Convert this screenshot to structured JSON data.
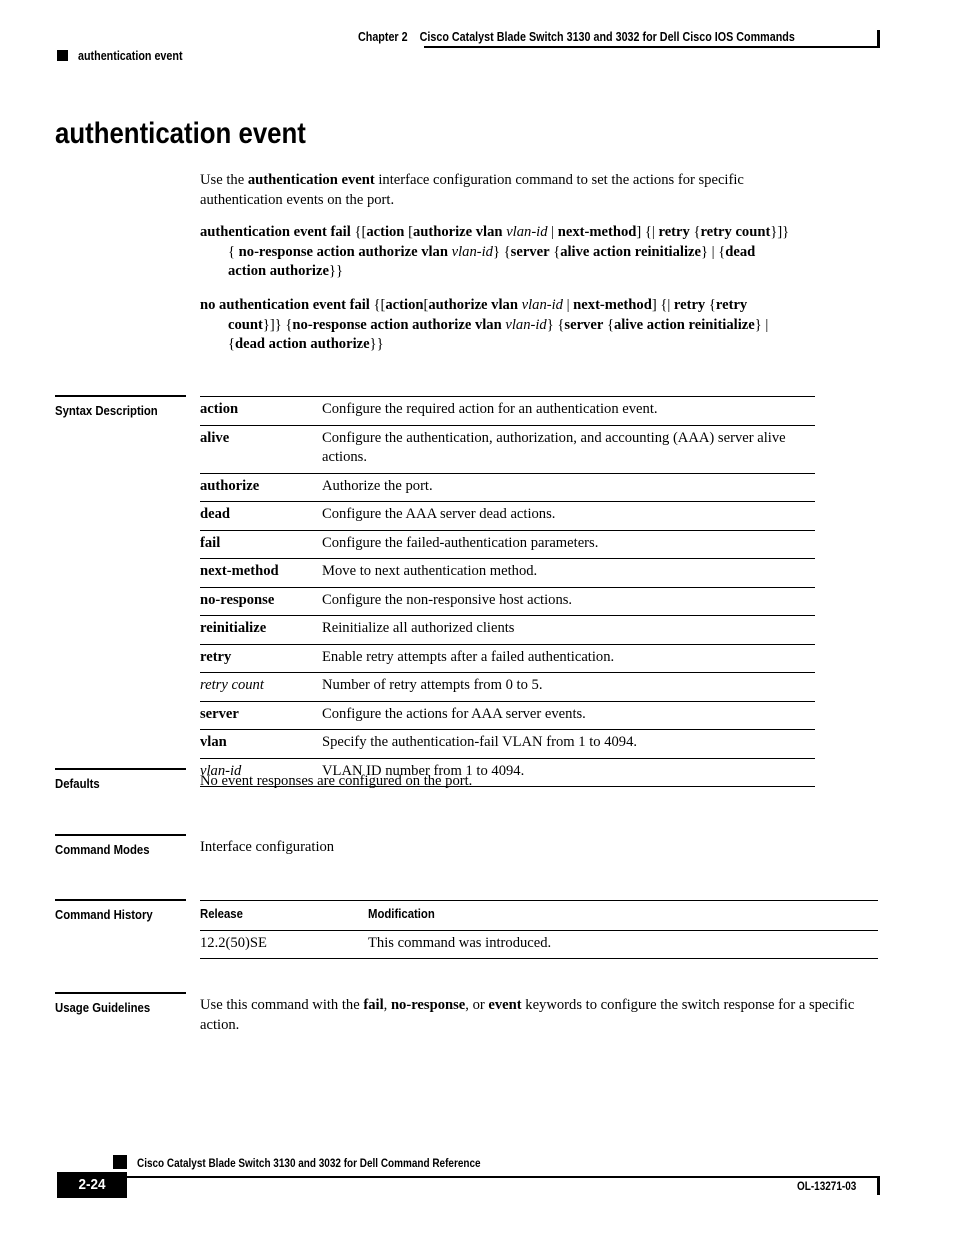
{
  "header": {
    "chapter": "Chapter 2",
    "book_title": "Cisco Catalyst Blade Switch 3130 and 3032 for Dell Cisco IOS Commands",
    "breadcrumb": "authentication event"
  },
  "page_title": "authentication event",
  "intro": {
    "before": "Use the ",
    "command": "authentication event",
    "after": " interface configuration command to set the actions for specific authentication events on the port."
  },
  "syntax": {
    "positive": {
      "line1": "authentication event fail {[action [authorize vlan vlan-id | next-method] {| retry {retry count}]}",
      "line2": "{ no-response action authorize vlan vlan-id} {server {alive action reinitialize} | {dead",
      "line3": "action authorize}}"
    },
    "negative": {
      "line1": "no authentication event fail {[action[authorize vlan vlan-id | next-method] {| retry {retry",
      "line2": "count}]} {no-response action authorize vlan vlan-id} {server {alive action reinitialize} |",
      "line3": "{dead action authorize}}"
    }
  },
  "sections": {
    "syntax_description": "Syntax Description",
    "defaults": "Defaults",
    "command_modes": "Command Modes",
    "command_history": "Command History",
    "usage_guidelines": "Usage Guidelines"
  },
  "syntax_table": {
    "rows": [
      {
        "keyword": "action",
        "style": "bold",
        "description": "Configure the required action for an authentication event."
      },
      {
        "keyword": "alive",
        "style": "bold",
        "description": "Configure the authentication, authorization, and accounting (AAA) server alive actions."
      },
      {
        "keyword": "authorize",
        "style": "bold",
        "description": "Authorize the port."
      },
      {
        "keyword": "dead",
        "style": "bold",
        "description": "Configure the AAA server dead actions."
      },
      {
        "keyword": "fail",
        "style": "bold",
        "description": "Configure the failed-authentication parameters."
      },
      {
        "keyword": "next-method",
        "style": "bold",
        "description": "Move to next authentication method."
      },
      {
        "keyword": "no-response",
        "style": "bold",
        "description": "Configure the non-responsive host actions."
      },
      {
        "keyword": "reinitialize",
        "style": "bold",
        "description": "Reinitialize all authorized clients"
      },
      {
        "keyword": "retry",
        "style": "bold",
        "description": "Enable retry attempts after a failed authentication."
      },
      {
        "keyword": "retry count",
        "style": "italic",
        "description": "Number of retry attempts from 0 to 5."
      },
      {
        "keyword": "server",
        "style": "bold",
        "description": "Configure the actions for AAA server events."
      },
      {
        "keyword": "vlan",
        "style": "bold",
        "description": "Specify the authentication-fail VLAN from 1 to 4094."
      },
      {
        "keyword": "vlan-id",
        "style": "italic",
        "description": "VLAN ID number from 1 to 4094."
      }
    ]
  },
  "defaults_text": "No event responses are configured on the port.",
  "command_modes_text": "Interface configuration",
  "history_table": {
    "headers": {
      "release": "Release",
      "modification": "Modification"
    },
    "rows": [
      {
        "release": "12.2(50)SE",
        "modification": "This command was introduced."
      }
    ]
  },
  "usage_guidelines": {
    "p1": "Use this command with the ",
    "kw1": "fail",
    "p2": ", ",
    "kw2": "no-response",
    "p3": ", or ",
    "kw3": "event",
    "p4": " keywords to configure the switch response for a specific action."
  },
  "footer": {
    "book_title": "Cisco Catalyst Blade Switch 3130 and 3032 for Dell Command Reference",
    "page_number": "2-24",
    "doc_id": "OL-13271-03"
  }
}
